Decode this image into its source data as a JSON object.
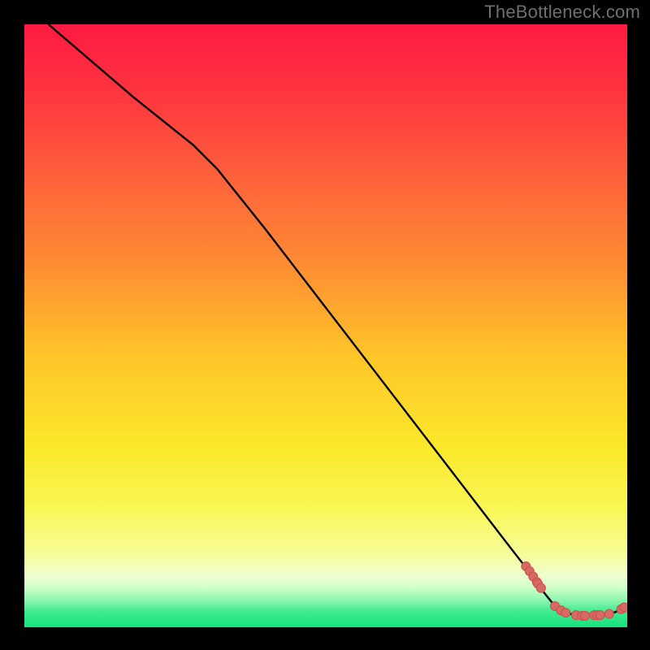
{
  "attribution": "TheBottleneck.com",
  "colors": {
    "point_fill": "#d76a63",
    "point_stroke": "#c94f46",
    "curve_stroke": "#000000"
  },
  "chart_data": {
    "type": "line",
    "title": "",
    "xlabel": "",
    "ylabel": "",
    "xlim": [
      0,
      100
    ],
    "ylim": [
      0,
      100
    ],
    "gradient_stops": [
      {
        "offset": 0.0,
        "color": "#ff1b41"
      },
      {
        "offset": 0.1,
        "color": "#ff3140"
      },
      {
        "offset": 0.25,
        "color": "#ff603b"
      },
      {
        "offset": 0.4,
        "color": "#ff8d33"
      },
      {
        "offset": 0.55,
        "color": "#ffc529"
      },
      {
        "offset": 0.7,
        "color": "#fbe82a"
      },
      {
        "offset": 0.8,
        "color": "#f9f754"
      },
      {
        "offset": 0.88,
        "color": "#f7fd9a"
      },
      {
        "offset": 0.915,
        "color": "#eefed1"
      },
      {
        "offset": 0.935,
        "color": "#ceffc9"
      },
      {
        "offset": 0.955,
        "color": "#8ef6ae"
      },
      {
        "offset": 0.975,
        "color": "#3de98f"
      },
      {
        "offset": 1.0,
        "color": "#17e37f"
      }
    ],
    "curve": [
      {
        "x": 4.0,
        "y": 100.0
      },
      {
        "x": 18.0,
        "y": 88.0
      },
      {
        "x": 28.0,
        "y": 80.0
      },
      {
        "x": 32.0,
        "y": 76.0
      },
      {
        "x": 40.0,
        "y": 66.0
      },
      {
        "x": 50.0,
        "y": 53.0
      },
      {
        "x": 60.0,
        "y": 40.0
      },
      {
        "x": 70.0,
        "y": 27.0
      },
      {
        "x": 80.0,
        "y": 14.0
      },
      {
        "x": 83.5,
        "y": 9.5
      },
      {
        "x": 86.0,
        "y": 6.0
      },
      {
        "x": 88.0,
        "y": 3.5
      },
      {
        "x": 90.0,
        "y": 2.3
      },
      {
        "x": 92.0,
        "y": 2.0
      },
      {
        "x": 94.0,
        "y": 2.0
      },
      {
        "x": 96.0,
        "y": 2.1
      },
      {
        "x": 98.0,
        "y": 2.5
      },
      {
        "x": 99.5,
        "y": 3.3
      }
    ],
    "points": [
      {
        "x": 83.2,
        "y": 10.1
      },
      {
        "x": 83.8,
        "y": 9.3
      },
      {
        "x": 84.4,
        "y": 8.4
      },
      {
        "x": 85.0,
        "y": 7.5
      },
      {
        "x": 85.2,
        "y": 7.2
      },
      {
        "x": 85.7,
        "y": 6.5
      },
      {
        "x": 88.0,
        "y": 3.5
      },
      {
        "x": 89.0,
        "y": 2.8
      },
      {
        "x": 89.8,
        "y": 2.4
      },
      {
        "x": 91.5,
        "y": 2.0
      },
      {
        "x": 92.5,
        "y": 1.9
      },
      {
        "x": 93.0,
        "y": 1.9
      },
      {
        "x": 94.5,
        "y": 2.0
      },
      {
        "x": 95.0,
        "y": 2.0
      },
      {
        "x": 95.5,
        "y": 2.0
      },
      {
        "x": 97.0,
        "y": 2.2
      },
      {
        "x": 99.0,
        "y": 3.0
      },
      {
        "x": 99.5,
        "y": 3.3
      }
    ]
  }
}
